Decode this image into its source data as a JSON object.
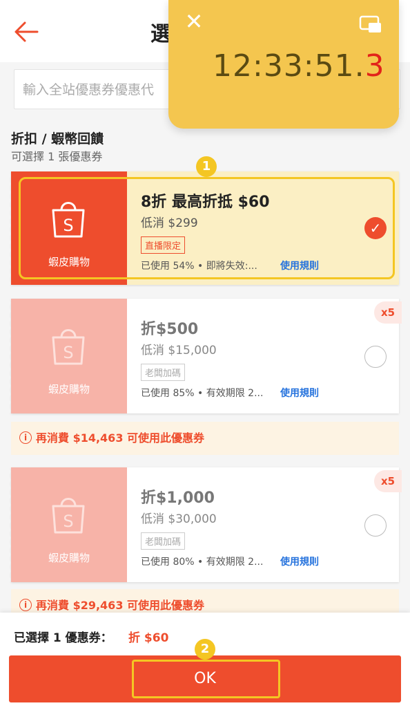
{
  "header": {
    "title": "選",
    "back_icon": "arrow-left-icon"
  },
  "search": {
    "placeholder": "輸入全站優惠券優惠代"
  },
  "section": {
    "title": "折扣 / 蝦幣回饋",
    "subtitle": "可選擇 1 張優惠券"
  },
  "vouchers": [
    {
      "brand": "蝦皮購物",
      "title": "8折 最高折抵 $60",
      "min_spend": "低消 $299",
      "tag": "直播限定",
      "usage": "已使用 54% • 即將失效:...",
      "rule": "使用規則",
      "selected": true
    },
    {
      "brand": "蝦皮購物",
      "title": "折$500",
      "min_spend": "低消 $15,000",
      "tag": "老闆加碼",
      "usage": "已使用 85% • 有效期限 2...",
      "rule": "使用規則",
      "qty": "x5",
      "warning": "再消費 $14,463 可使用此優惠券",
      "selected": false
    },
    {
      "brand": "蝦皮購物",
      "title": "折$1,000",
      "min_spend": "低消 $30,000",
      "tag": "老闆加碼",
      "usage": "已使用 80% • 有效期限 2...",
      "rule": "使用規則",
      "qty": "x5",
      "warning": "再消費 $29,463 可使用此優惠券",
      "selected": false
    }
  ],
  "bottom": {
    "selected_label": "已選擇 1 優惠券：",
    "selected_value": "折 $60",
    "ok_label": "OK"
  },
  "steps": [
    "1",
    "2"
  ],
  "timer": {
    "time_main": "12:33:51.",
    "time_fraction": "3",
    "close_icon": "close-icon",
    "pip_icon": "picture-in-picture-icon"
  },
  "colors": {
    "accent": "#ee4d2d",
    "voucher_disabled": "#f7b3a8",
    "highlight": "#f4c623",
    "link": "#2673dd",
    "warning_bg": "#fdf3e3",
    "timer_bg": "#f4c64f"
  }
}
